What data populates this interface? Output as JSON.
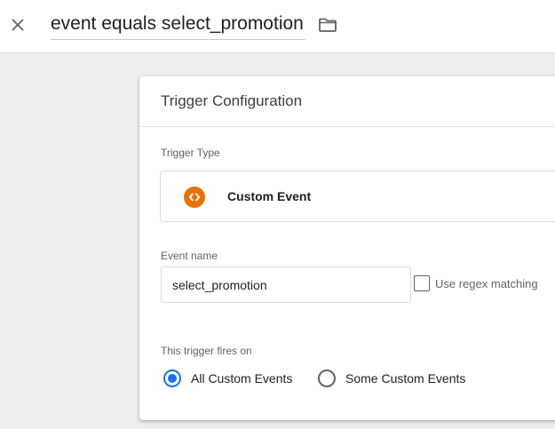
{
  "header": {
    "close_icon": "close-icon",
    "title": "event equals select_promotion",
    "folder_icon": "folder-icon"
  },
  "trigger_config": {
    "heading": "Trigger Configuration",
    "trigger_type": {
      "label": "Trigger Type",
      "selected": "Custom Event",
      "icon": "code-brackets-icon",
      "icon_color": "#e8710a"
    },
    "event_name": {
      "label": "Event name",
      "value": "select_promotion"
    },
    "regex": {
      "label": "Use regex matching",
      "checked": false
    },
    "fires_on": {
      "label": "This trigger fires on",
      "options": [
        {
          "label": "All Custom Events",
          "selected": true
        },
        {
          "label": "Some Custom Events",
          "selected": false
        }
      ]
    }
  },
  "colors": {
    "accent": "#1a73e8",
    "event_icon": "#e8710a"
  }
}
